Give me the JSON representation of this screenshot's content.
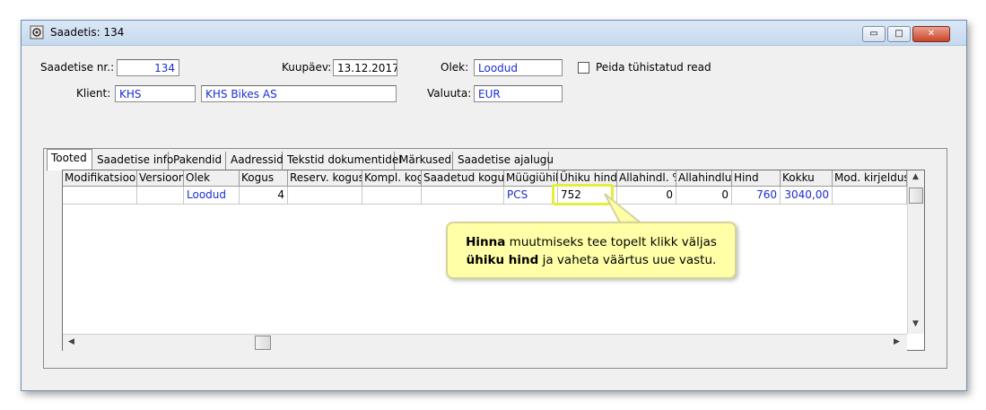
{
  "window": {
    "title": "Saadetis: 134",
    "buttons": {
      "minimize": "▭",
      "maximize": "□",
      "close": "✕"
    }
  },
  "form": {
    "shipment_no": {
      "label": "Saadetise nr.:",
      "value": "134"
    },
    "date": {
      "label": "Kuupäev:",
      "value": "13.12.2017"
    },
    "status": {
      "label": "Olek:",
      "value": "Loodud"
    },
    "hide_cancelled": {
      "label": "Peida tühistatud read",
      "checked": false
    },
    "client": {
      "label": "Klient:",
      "code": "KHS",
      "name": "KHS Bikes AS"
    },
    "currency": {
      "label": "Valuuta:",
      "value": "EUR"
    }
  },
  "tabs": [
    "Tooted",
    "Saadetise info",
    "Pakendid",
    "Aadressid",
    "Tekstid dokumentidel",
    "Märkused",
    "Saadetise ajalugu"
  ],
  "active_tab": "Tooted",
  "grid": {
    "headers": [
      "Modifikatsioon",
      "Versioon",
      "Olek",
      "Kogus",
      "Reserv. kogus",
      "Kompl. kogus",
      "Saadetud kogus",
      "Müügiühik",
      "Ühiku hind",
      "Allahindl. %",
      "Allahindlus",
      "Hind",
      "Kokku",
      "Mod. kirjeldus"
    ],
    "rows": [
      [
        "",
        "",
        "Loodud",
        "4",
        "",
        "",
        "",
        "PCS",
        "752",
        "0",
        "0",
        "760",
        "3040,00",
        ""
      ]
    ]
  },
  "callout": {
    "bold1": "Hinna",
    "text1": " muutmiseks tee topelt klikk väljas",
    "bold2": "ühiku hind",
    "text2": " ja vaheta väärtus uue vastu."
  },
  "colors": {
    "value_text": "#1a2fd0",
    "callout_bg": "#ffffa8",
    "highlight": "#e5ef3a"
  }
}
